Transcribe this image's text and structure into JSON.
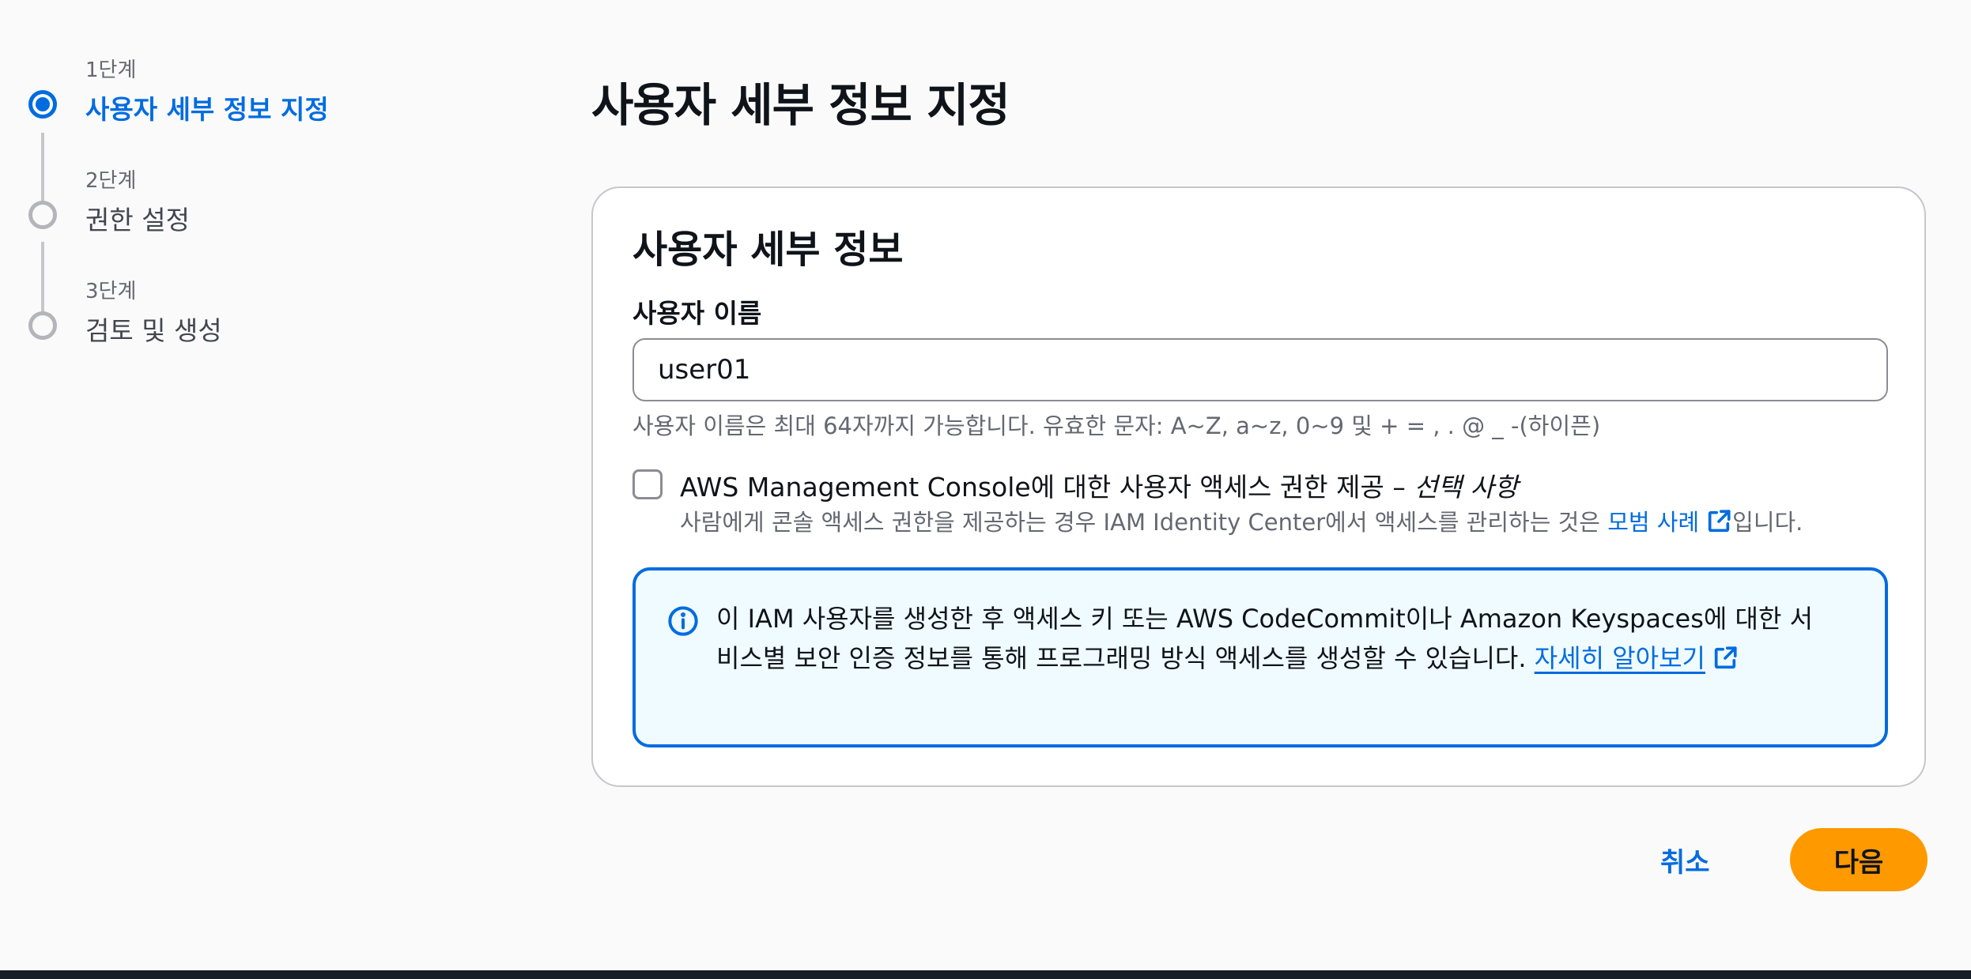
{
  "stepper": {
    "steps": [
      {
        "number": "1단계",
        "title": "사용자 세부 정보 지정",
        "state": "active"
      },
      {
        "number": "2단계",
        "title": "권한 설정",
        "state": "inactive"
      },
      {
        "number": "3단계",
        "title": "검토 및 생성",
        "state": "inactive"
      }
    ]
  },
  "page": {
    "title": "사용자 세부 정보 지정"
  },
  "card": {
    "title": "사용자 세부 정보",
    "username_label": "사용자 이름",
    "username_value": "user01",
    "username_constraint": "사용자 이름은 최대 64자까지 가능합니다. 유효한 문자: A~Z, a~z, 0~9 및 + = , . @ _ -(하이픈)",
    "console_access": {
      "checked": false,
      "label": "AWS Management Console에 대한 사용자 액세스 권한 제공 – ",
      "optional": "선택 사항",
      "desc_prefix": "사람에게 콘솔 액세스 권한을 제공하는 경우 IAM Identity Center에서 액세스를 관리하는 것은 ",
      "desc_link": "모범 사례",
      "desc_suffix": "입니다."
    },
    "info_alert": {
      "text": "이 IAM 사용자를 생성한 후 액세스 키 또는 AWS CodeCommit이나 Amazon Keyspaces에 대한 서비스별 보안 인증 정보를 통해 프로그래밍 방식 액세스를 생성할 수 있습니다. ",
      "link": "자세히 알아보기",
      "icon": "info-icon"
    }
  },
  "footer": {
    "cancel_label": "취소",
    "next_label": "다음"
  },
  "colors": {
    "accent": "#006ce0",
    "primary_button": "#ff9900",
    "alert_background": "#f0fbff"
  }
}
